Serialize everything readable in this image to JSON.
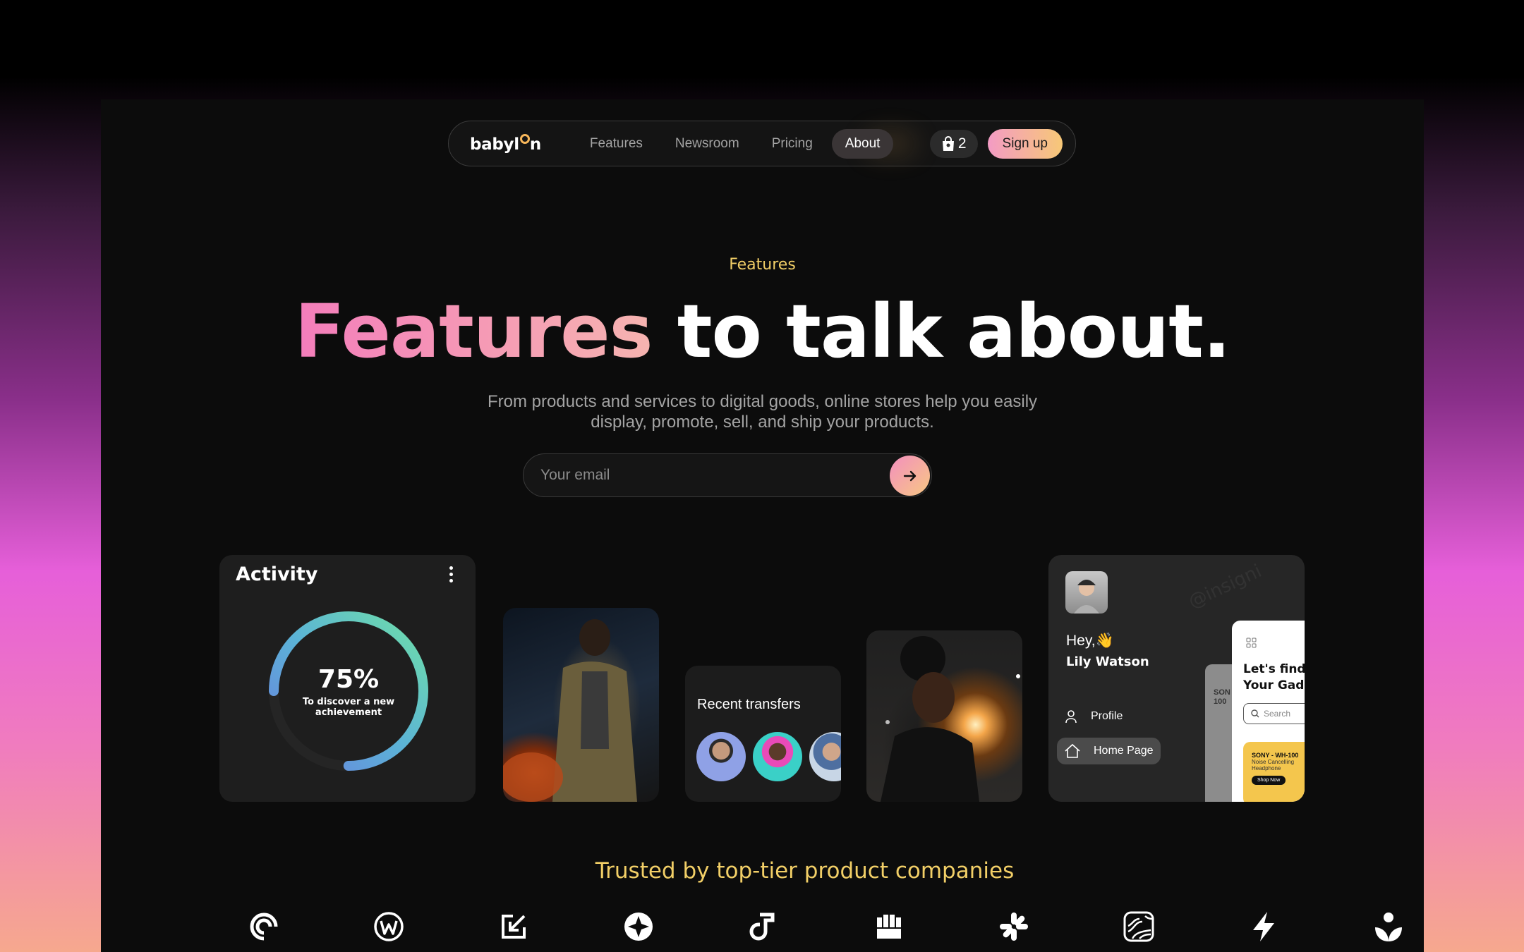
{
  "nav": {
    "logo_prefix": "babyl",
    "logo_suffix": "n",
    "links": [
      "Features",
      "Newsroom",
      "Pricing",
      "About"
    ],
    "active": "About",
    "cart_count": "2",
    "signup": "Sign up"
  },
  "hero": {
    "eyebrow": "Features",
    "headline_highlight": "Features",
    "headline_rest": " to talk about.",
    "subtitle_line1": "From products and services to digital goods, online stores help you easily",
    "subtitle_line2": "display, promote, sell, and ship your products.",
    "email_placeholder": "Your email"
  },
  "activity_card": {
    "title": "Activity",
    "progress": 75,
    "percent_label": "75%",
    "caption": "To discover a new achievement"
  },
  "transfers_card": {
    "title": "Recent transfers"
  },
  "app_card": {
    "greeting": "Hey,👋",
    "user_name": "Lily Watson",
    "menu": [
      "Profile",
      "Home Page"
    ],
    "selected": "Home Page",
    "phone_title": "Let's find Your Gadg",
    "search_placeholder": "Search",
    "promo_title": "SONY - WH-100",
    "promo_sub": "Noise Cancelling Headphone",
    "promo_button": "Shop Now",
    "back_screen_text": "SON 100",
    "watermark": "@insigni"
  },
  "trusted": {
    "title": "Trusted by top-tier product companies",
    "logos": [
      "spiral-logo-icon",
      "w-circle-logo-icon",
      "arrow-square-logo-icon",
      "star-circle-logo-icon",
      "j-note-logo-icon",
      "fist-logo-icon",
      "asterisk-logo-icon",
      "topography-logo-icon",
      "bolt-logo-icon",
      "flower-logo-icon"
    ]
  },
  "colors": {
    "accent_yellow": "#f2cf67",
    "accent_pink": "#f47dbb",
    "frame_bg": "#0c0c0c"
  }
}
